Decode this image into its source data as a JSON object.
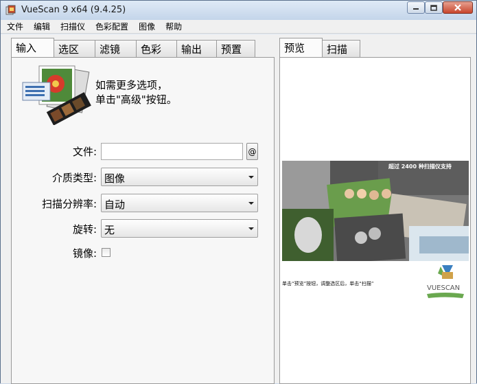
{
  "window": {
    "title": "VueScan 9 x64 (9.4.25)",
    "controls": [
      "minimize-icon",
      "maximize-icon",
      "close-icon"
    ]
  },
  "menu": [
    "文件",
    "编辑",
    "扫描仪",
    "色彩配置",
    "图像",
    "帮助"
  ],
  "left_tabs": [
    "输入",
    "选区",
    "滤镜",
    "色彩",
    "输出",
    "预置"
  ],
  "left_active_tab": "输入",
  "right_tabs": [
    "预览",
    "扫描"
  ],
  "right_active_tab": "预览",
  "hint": {
    "line1": "如需更多选项，",
    "line2": "单击\"高级\"按钮。"
  },
  "form": {
    "file_label": "文件:",
    "file_value": "",
    "file_button": "@",
    "media_label": "介质类型:",
    "media_value": "图像",
    "resolution_label": "扫描分辨率:",
    "resolution_value": "自动",
    "rotate_label": "旋转:",
    "rotate_value": "无",
    "mirror_label": "镜像:",
    "mirror_checked": false
  },
  "preview": {
    "banner_text": "单击“预览”按钮，调整选区后，单击“扫描”",
    "overlay_text": "超过 2400 种扫描仪支持",
    "logo_text": "VUESCAN"
  }
}
